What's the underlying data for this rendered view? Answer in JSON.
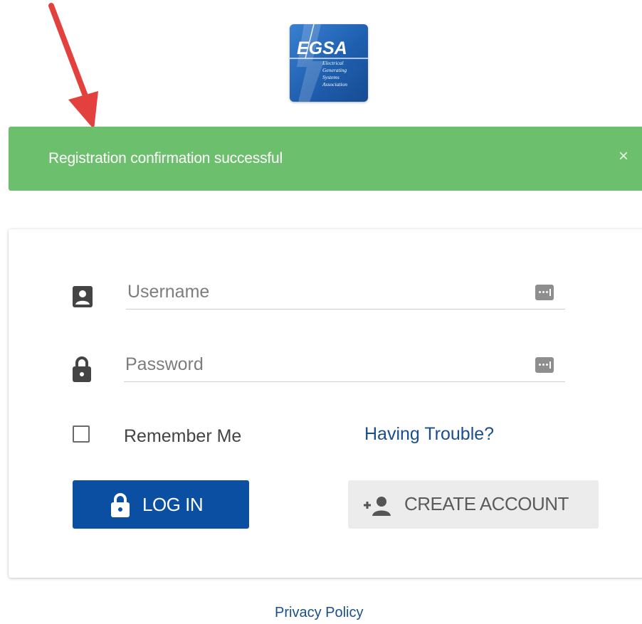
{
  "logo": {
    "acronym": "EGSA",
    "lines": [
      "Electrical",
      "Generating",
      "Systems",
      "Association"
    ]
  },
  "alert": {
    "message": "Registration confirmation successful",
    "close_symbol": "×",
    "color": "#6cbf6c"
  },
  "login": {
    "username_placeholder": "Username",
    "password_placeholder": "Password",
    "remember_label": "Remember Me",
    "remember_checked": false,
    "trouble_link": "Having Trouble?",
    "login_button": "LOG IN",
    "create_button": "CREATE ACCOUNT"
  },
  "footer": {
    "privacy_link": "Privacy Policy"
  },
  "colors": {
    "primary": "#0b4fa2",
    "link": "#1a4f8a",
    "annotation_arrow": "#e2413e"
  },
  "icons": {
    "username": "user-badge-icon",
    "password": "lock-icon",
    "password_manager": "password-key-icon",
    "login": "lock-icon",
    "create": "add-person-icon"
  }
}
